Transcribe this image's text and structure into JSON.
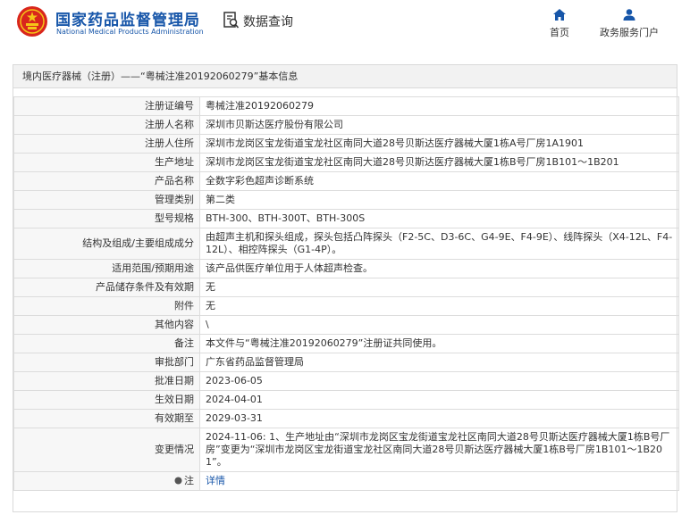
{
  "header": {
    "logo_cn": "国家药品监督管理局",
    "logo_en": "National Medical Products Administration",
    "query_label": "数据查询",
    "nav": [
      {
        "label": "首页",
        "icon": "home-icon"
      },
      {
        "label": "政务服务门户",
        "icon": "user-icon"
      }
    ],
    "accent_color": "#1756a9"
  },
  "panel": {
    "title": "境内医疗器械（注册）——“粤械注准20192060279”基本信息"
  },
  "rows": [
    {
      "label": "注册证编号",
      "value": "粤械注准20192060279"
    },
    {
      "label": "注册人名称",
      "value": "深圳市贝斯达医疗股份有限公司"
    },
    {
      "label": "注册人住所",
      "value": "深圳市龙岗区宝龙街道宝龙社区南同大道28号贝斯达医疗器械大厦1栋A号厂房1A1901"
    },
    {
      "label": "生产地址",
      "value": "深圳市龙岗区宝龙街道宝龙社区南同大道28号贝斯达医疗器械大厦1栋B号厂房1B101～1B201"
    },
    {
      "label": "产品名称",
      "value": "全数字彩色超声诊断系统"
    },
    {
      "label": "管理类别",
      "value": "第二类"
    },
    {
      "label": "型号规格",
      "value": "BTH-300、BTH-300T、BTH-300S"
    },
    {
      "label": "结构及组成/主要组成成分",
      "value": "由超声主机和探头组成，探头包括凸阵探头（F2-5C、D3-6C、G4-9E、F4-9E）、线阵探头（X4-12L、F4-12L）、相控阵探头（G1-4P）。"
    },
    {
      "label": "适用范围/预期用途",
      "value": "该产品供医疗单位用于人体超声检查。"
    },
    {
      "label": "产品储存条件及有效期",
      "value": "无"
    },
    {
      "label": "附件",
      "value": "无"
    },
    {
      "label": "其他内容",
      "value": "\\"
    },
    {
      "label": "备注",
      "value": "本文件与“粤械注准20192060279”注册证共同使用。"
    },
    {
      "label": "审批部门",
      "value": "广东省药品监督管理局"
    },
    {
      "label": "批准日期",
      "value": "2023-06-05"
    },
    {
      "label": "生效日期",
      "value": "2024-04-01"
    },
    {
      "label": "有效期至",
      "value": "2029-03-31"
    },
    {
      "label": "变更情况",
      "value": "2024-11-06: 1、生产地址由“深圳市龙岗区宝龙街道宝龙社区南同大道28号贝斯达医疗器械大厦1栋B号厂房”变更为“深圳市龙岗区宝龙街道宝龙社区南同大道28号贝斯达医疗器械大厦1栋B号厂房1B101～1B201”。"
    }
  ],
  "note": {
    "label": "注",
    "link": "详情"
  }
}
